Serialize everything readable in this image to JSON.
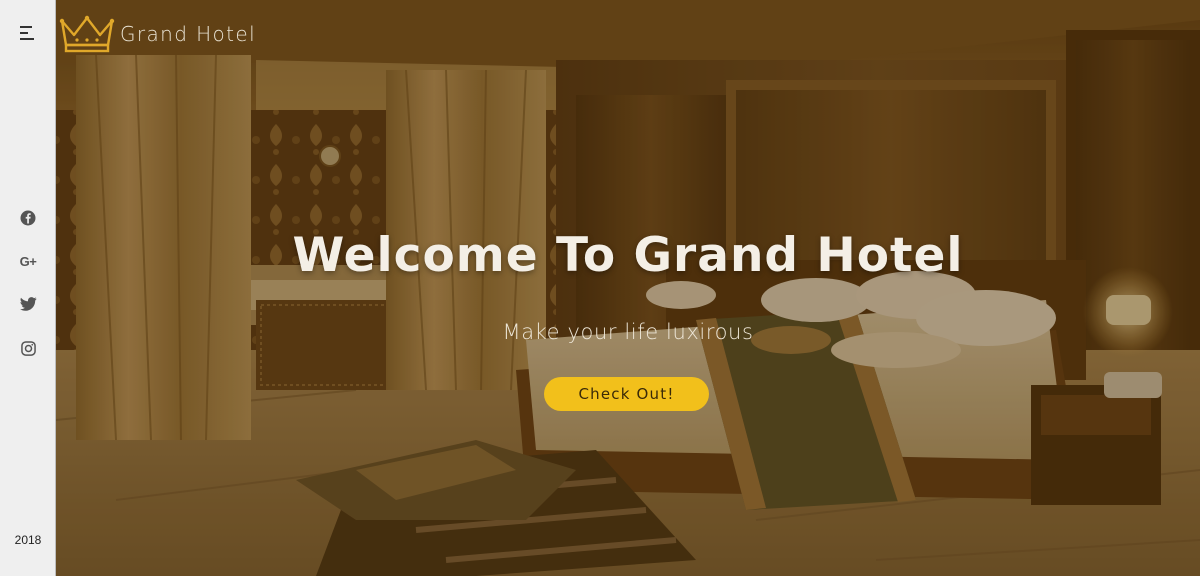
{
  "sidebar": {
    "menu_icon": "hamburger-menu-icon",
    "social": [
      {
        "name": "facebook",
        "icon": "facebook-icon"
      },
      {
        "name": "google-plus",
        "icon": "google-plus-icon",
        "glyph": "G+"
      },
      {
        "name": "twitter",
        "icon": "twitter-icon"
      },
      {
        "name": "instagram",
        "icon": "instagram-icon"
      }
    ],
    "year": "2018"
  },
  "brand": {
    "logo_icon": "crown-icon",
    "name": "Grand Hotel"
  },
  "hero": {
    "headline": "Welcome To Grand Hotel",
    "tagline": "Make your life luxirous",
    "cta_label": "Check Out!",
    "background": "hotel-bedroom-photo"
  },
  "colors": {
    "accent": "#f2c01b",
    "sidebar_bg": "#efefef",
    "overlay": "#3a2408",
    "text_light": "#f4efe6"
  }
}
